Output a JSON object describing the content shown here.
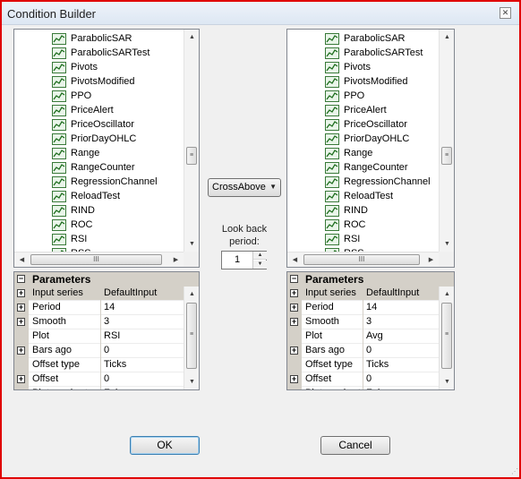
{
  "window": {
    "title": "Condition Builder"
  },
  "left_list": {
    "items": [
      "ParabolicSAR",
      "ParabolicSARTest",
      "Pivots",
      "PivotsModified",
      "PPO",
      "PriceAlert",
      "PriceOscillator",
      "PriorDayOHLC",
      "Range",
      "RangeCounter",
      "RegressionChannel",
      "ReloadTest",
      "RIND",
      "ROC",
      "RSI",
      "RSS"
    ]
  },
  "right_list": {
    "items": [
      "ParabolicSAR",
      "ParabolicSARTest",
      "Pivots",
      "PivotsModified",
      "PPO",
      "PriceAlert",
      "PriceOscillator",
      "PriorDayOHLC",
      "Range",
      "RangeCounter",
      "RegressionChannel",
      "ReloadTest",
      "RIND",
      "ROC",
      "RSI",
      "RSS"
    ]
  },
  "left_params": {
    "header": "Parameters",
    "rows": [
      {
        "expander": "+",
        "name": "Input series",
        "value": "DefaultInput"
      },
      {
        "expander": "+",
        "name": "Period",
        "value": "14"
      },
      {
        "expander": "+",
        "name": "Smooth",
        "value": "3"
      },
      {
        "expander": "",
        "name": "Plot",
        "value": "RSI"
      },
      {
        "expander": "+",
        "name": "Bars ago",
        "value": "0"
      },
      {
        "expander": "",
        "name": "Offset type",
        "value": "Ticks"
      },
      {
        "expander": "+",
        "name": "Offset",
        "value": "0"
      },
      {
        "expander": "",
        "name": "Plot on chart",
        "value": "False"
      }
    ]
  },
  "right_params": {
    "header": "Parameters",
    "rows": [
      {
        "expander": "+",
        "name": "Input series",
        "value": "DefaultInput"
      },
      {
        "expander": "+",
        "name": "Period",
        "value": "14"
      },
      {
        "expander": "+",
        "name": "Smooth",
        "value": "3"
      },
      {
        "expander": "",
        "name": "Plot",
        "value": "Avg"
      },
      {
        "expander": "+",
        "name": "Bars ago",
        "value": "0"
      },
      {
        "expander": "",
        "name": "Offset type",
        "value": "Ticks"
      },
      {
        "expander": "+",
        "name": "Offset",
        "value": "0"
      },
      {
        "expander": "",
        "name": "Plot on chart",
        "value": "False"
      }
    ]
  },
  "condition": {
    "operator": "CrossAbove"
  },
  "lookback": {
    "label_line1": "Look back",
    "label_line2": "period:",
    "value": "1"
  },
  "buttons": {
    "ok": "OK",
    "cancel": "Cancel"
  },
  "icons": {
    "list_item": "indicator-chart-icon",
    "close": "close-icon"
  }
}
